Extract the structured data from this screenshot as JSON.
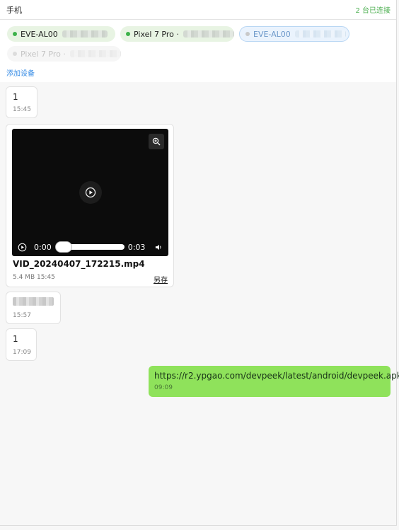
{
  "header": {
    "title": "手机",
    "connected": "2 台已连接",
    "devices": [
      {
        "name": "EVE-AL00",
        "state": "online"
      },
      {
        "name": "Pixel 7 Pro ·",
        "state": "online"
      },
      {
        "name": "EVE-AL00",
        "state": "selected"
      },
      {
        "name": "Pixel 7 Pro ·",
        "state": "offline"
      }
    ],
    "add_device": "添加设备"
  },
  "messages": [
    {
      "text": "1",
      "time": "15:45"
    },
    {
      "video": {
        "current_time": "0:00",
        "duration": "0:03",
        "file_name": "VID_20240407_172215.mp4",
        "meta": "5.4 MB  15:45",
        "save_as": "另存"
      }
    },
    {
      "time": "15:57"
    },
    {
      "text": "1",
      "time": "17:09"
    },
    {
      "text": "https://r2.ypgao.com/devpeek/latest/android/devpeek.apk",
      "time": "09:09",
      "sent": true
    }
  ],
  "colors": {
    "online_dot": "#3db24a",
    "connected_text": "#4caf50",
    "sent_bubble": "#8fe25b",
    "link": "#3a8ee6"
  }
}
